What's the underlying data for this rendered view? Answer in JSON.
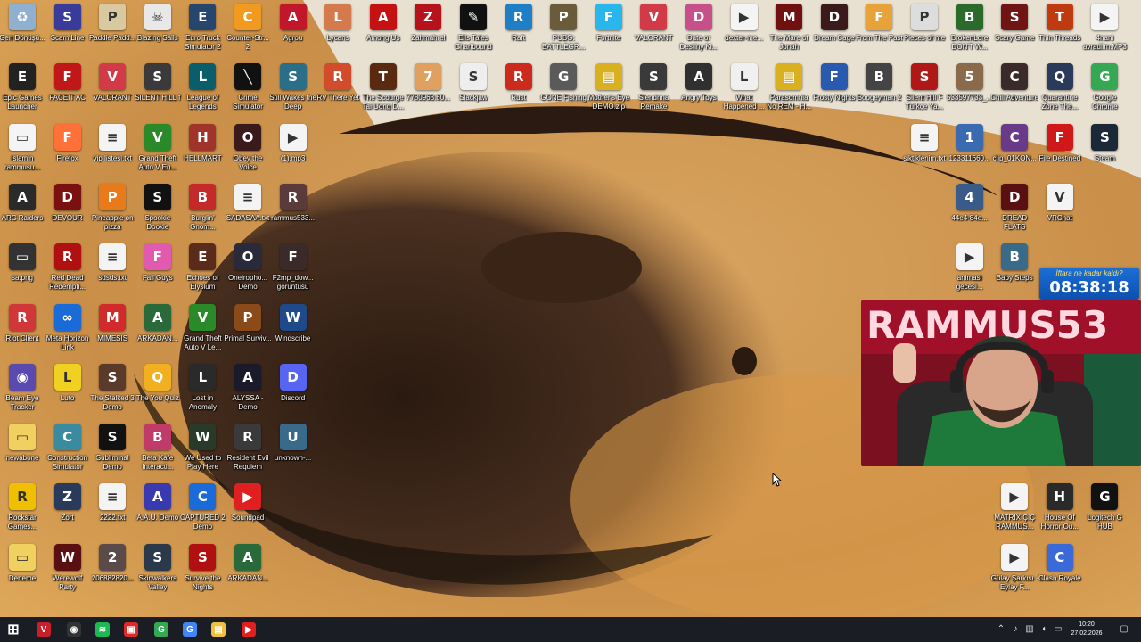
{
  "desktop": {
    "icons": [
      {
        "label": "Geri Dönüşü...",
        "color": "#8fb0d0",
        "glyph": "♻",
        "icon": "recycle-bin-icon"
      },
      {
        "label": "Scam Line",
        "color": "#3a3a9a",
        "glyph": "S",
        "icon": "game-icon"
      },
      {
        "label": "Paddle Padd...",
        "color": "#d9c9a0",
        "glyph": "P",
        "icon": "game-icon"
      },
      {
        "label": "Blazing Sails",
        "color": "#e8e8e8",
        "glyph": "☠",
        "icon": "game-icon"
      },
      {
        "label": "Euro Truck Simulator 2",
        "color": "#26466e",
        "glyph": "E",
        "icon": "game-icon"
      },
      {
        "label": "Counter-Str... 2",
        "color": "#f29a1f",
        "glyph": "C",
        "icon": "game-icon"
      },
      {
        "label": "Agrou",
        "color": "#c0182a",
        "glyph": "A",
        "icon": "game-icon"
      },
      {
        "label": "Lycans",
        "color": "#d57a4c",
        "glyph": "L",
        "icon": "game-icon"
      },
      {
        "label": "Among Us",
        "color": "#c51111",
        "glyph": "A",
        "icon": "game-icon"
      },
      {
        "label": "Zahmahrel",
        "color": "#b5121b",
        "glyph": "Z",
        "icon": "game-icon"
      },
      {
        "label": "Ells Tales Charlbound",
        "color": "#111",
        "glyph": "✎",
        "icon": "game-icon"
      },
      {
        "label": "Raft",
        "color": "#1f7fc6",
        "glyph": "R",
        "icon": "game-icon"
      },
      {
        "label": "PUBG: BATTLEGR...",
        "color": "#6a5b3a",
        "glyph": "P",
        "icon": "game-icon"
      },
      {
        "label": "Fortnite",
        "color": "#29b6ec",
        "glyph": "F",
        "icon": "game-icon"
      },
      {
        "label": "VALORANT",
        "color": "#d33a48",
        "glyph": "V",
        "icon": "game-icon"
      },
      {
        "label": "Date or Destiny Ki...",
        "color": "#c7508a",
        "glyph": "D",
        "icon": "game-icon"
      },
      {
        "label": "dexter-me...",
        "color": "#f4f4f4",
        "glyph": "▶",
        "icon": "video-file-icon"
      },
      {
        "label": "The Mare of Jonah",
        "color": "#701010",
        "glyph": "M",
        "icon": "game-icon"
      },
      {
        "label": "Dream Cage",
        "color": "#3a1a1a",
        "glyph": "D",
        "icon": "game-icon"
      },
      {
        "label": "From The Past",
        "color": "#e8a23a",
        "glyph": "F",
        "icon": "game-icon"
      },
      {
        "label": "Pieces of me",
        "color": "#dddddd",
        "glyph": "P",
        "icon": "game-icon"
      },
      {
        "label": "BrokenLore DON'T W...",
        "color": "#2a6a2a",
        "glyph": "B",
        "icon": "game-icon"
      },
      {
        "label": "Scary Game",
        "color": "#701414",
        "glyph": "S",
        "icon": "game-icon"
      },
      {
        "label": "Thin Threads",
        "color": "#c03a10",
        "glyph": "T",
        "icon": "game-icon"
      },
      {
        "label": "4nani avradiim.MP3",
        "color": "#f4f4f4",
        "glyph": "▶",
        "icon": "audio-file-icon"
      },
      {
        "label": "Epic Games Launcher",
        "color": "#222",
        "glyph": "E",
        "icon": "epic-games-icon"
      },
      {
        "label": "FACEIT AC",
        "color": "#c01818",
        "glyph": "F",
        "icon": "faceit-icon"
      },
      {
        "label": "VALORANT",
        "color": "#d33a48",
        "glyph": "V",
        "icon": "game-icon"
      },
      {
        "label": "SILENT HILL f",
        "color": "#3a3a3a",
        "glyph": "S",
        "icon": "game-icon"
      },
      {
        "label": "League of Legends",
        "color": "#0a5d6a",
        "glyph": "L",
        "icon": "game-icon"
      },
      {
        "label": "Crime Simulator",
        "color": "#111",
        "glyph": "╲",
        "icon": "game-icon"
      },
      {
        "label": "Still Wakes the Deep",
        "color": "#2a6e8a",
        "glyph": "S",
        "icon": "game-icon"
      },
      {
        "label": "RV There Yet",
        "color": "#d24b2a",
        "glyph": "R",
        "icon": "game-icon"
      },
      {
        "label": "The Scourge Tai Uong D...",
        "color": "#5a2a10",
        "glyph": "T",
        "icon": "game-icon"
      },
      {
        "label": "7780968.60...",
        "color": "#e0a060",
        "glyph": "7",
        "icon": "image-file-icon"
      },
      {
        "label": "Slackjaw",
        "color": "#eeeeee",
        "glyph": "S",
        "icon": "game-icon"
      },
      {
        "label": "Rust",
        "color": "#cd2a1e",
        "glyph": "R",
        "icon": "game-icon"
      },
      {
        "label": "GONE Fishing",
        "color": "#5a5a5a",
        "glyph": "G",
        "icon": "game-icon"
      },
      {
        "label": "Mother's Eye DEMO.zip",
        "color": "#d8b020",
        "glyph": "▤",
        "icon": "zip-file-icon"
      },
      {
        "label": "Slendrina Remake",
        "color": "#3a3a3a",
        "glyph": "S",
        "icon": "game-icon"
      },
      {
        "label": "Angry Toys",
        "color": "#303030",
        "glyph": "A",
        "icon": "game-icon"
      },
      {
        "label": "What Happened ...",
        "color": "#f0f0f0",
        "glyph": "L",
        "icon": "game-icon"
      },
      {
        "label": "Parasomnia No REM - H...",
        "color": "#d8b020",
        "glyph": "▤",
        "icon": "zip-file-icon"
      },
      {
        "label": "Frosty Nights",
        "color": "#2a5ab0",
        "glyph": "F",
        "icon": "game-icon"
      },
      {
        "label": "Boogeyman 2",
        "color": "#444",
        "glyph": "B",
        "icon": "game-icon"
      },
      {
        "label": "Silent Hill F Türkçe Ya...",
        "color": "#b01818",
        "glyph": "S",
        "icon": "game-icon"
      },
      {
        "label": "533597733_...",
        "color": "#8a6a4a",
        "glyph": "5",
        "icon": "image-file-icon"
      },
      {
        "label": "Chill Adventure",
        "color": "#3a2a2a",
        "glyph": "C",
        "icon": "game-icon"
      },
      {
        "label": "Quarantine Zone The...",
        "color": "#2a3a5a",
        "glyph": "Q",
        "icon": "game-icon"
      },
      {
        "label": "Google Chrome",
        "color": "#34a853",
        "glyph": "G",
        "icon": "chrome-icon"
      },
      {
        "label": "islamin rammusu...",
        "color": "#f4f4f4",
        "glyph": "▭",
        "icon": "file-icon"
      },
      {
        "label": "Firefox",
        "color": "#ff7139",
        "glyph": "F",
        "icon": "firefox-icon"
      },
      {
        "label": "vip listesi.txt",
        "color": "#f4f4f4",
        "glyph": "≡",
        "icon": "text-file-icon"
      },
      {
        "label": "Grand Theft Auto V En...",
        "color": "#2a8a2a",
        "glyph": "V",
        "icon": "game-icon"
      },
      {
        "label": "HELLMART",
        "color": "#a0342a",
        "glyph": "H",
        "icon": "game-icon"
      },
      {
        "label": "Obey the Voice",
        "color": "#3a1a1a",
        "glyph": "O",
        "icon": "game-icon"
      },
      {
        "label": "(1).mp3",
        "color": "#f4f4f4",
        "glyph": "▶",
        "icon": "audio-file-icon"
      },
      {
        "label": "siktiklenim.txt",
        "color": "#f4f4f4",
        "glyph": "≡",
        "icon": "text-file-icon"
      },
      {
        "label": "123311660...",
        "color": "#3a6ab0",
        "glyph": "1",
        "icon": "image-file-icon"
      },
      {
        "label": "clip_01KON...",
        "color": "#6a3a8a",
        "glyph": "C",
        "icon": "video-file-icon"
      },
      {
        "label": "File Destined",
        "color": "#d01818",
        "glyph": "F",
        "icon": "game-icon"
      },
      {
        "label": "Steam",
        "color": "#1b2838",
        "glyph": "S",
        "icon": "steam-icon"
      },
      {
        "label": "ARC Raiders",
        "color": "#2a2a2a",
        "glyph": "A",
        "icon": "game-icon"
      },
      {
        "label": "DEVOUR",
        "color": "#7a1010",
        "glyph": "D",
        "icon": "game-icon"
      },
      {
        "label": "Pineapple on pizza",
        "color": "#e87a1a",
        "glyph": "P",
        "icon": "game-icon"
      },
      {
        "label": "Spookie Dookie",
        "color": "#111",
        "glyph": "S",
        "icon": "game-icon"
      },
      {
        "label": "Burglin' Gnom...",
        "color": "#c42a2a",
        "glyph": "B",
        "icon": "game-icon"
      },
      {
        "label": "SADASAA.txt",
        "color": "#f4f4f4",
        "glyph": "≡",
        "icon": "text-file-icon"
      },
      {
        "label": "rammus533...",
        "color": "#5a3a3a",
        "glyph": "R",
        "icon": "image-file-icon"
      },
      {
        "label": "44e4-84e...",
        "color": "#3a5a8a",
        "glyph": "4",
        "icon": "image-file-icon"
      },
      {
        "label": "DREAD FLATS",
        "color": "#5a1010",
        "glyph": "D",
        "icon": "game-icon"
      },
      {
        "label": "VRChat",
        "color": "#f4f4f4",
        "glyph": "V",
        "icon": "vrchat-icon"
      },
      {
        "label": "sa.png",
        "color": "#333",
        "glyph": "▭",
        "icon": "image-file-icon"
      },
      {
        "label": "Red Dead Redempti...",
        "color": "#b01010",
        "glyph": "R",
        "icon": "game-icon"
      },
      {
        "label": "sdsds.txt",
        "color": "#f4f4f4",
        "glyph": "≡",
        "icon": "text-file-icon"
      },
      {
        "label": "Fall Guys",
        "color": "#e05ab0",
        "glyph": "F",
        "icon": "game-icon"
      },
      {
        "label": "Echoes of Elysium",
        "color": "#5a2a1a",
        "glyph": "E",
        "icon": "game-icon"
      },
      {
        "label": "Oneiropho... Demo",
        "color": "#2a2a3a",
        "glyph": "O",
        "icon": "game-icon"
      },
      {
        "label": "F2mp_dow... görüntüsü",
        "color": "#3a2a2a",
        "glyph": "F",
        "icon": "image-file-icon"
      },
      {
        "label": "animasi gecesi...",
        "color": "#f4f4f4",
        "glyph": "▶",
        "icon": "video-file-icon"
      },
      {
        "label": "Baby Steps",
        "color": "#3a6a8a",
        "glyph": "B",
        "icon": "game-icon"
      },
      {
        "label": "Riot Client",
        "color": "#d13639",
        "glyph": "R",
        "icon": "riot-client-icon"
      },
      {
        "label": "Meta Horizon Link",
        "color": "#1a6ad8",
        "glyph": "∞",
        "icon": "meta-horizon-icon"
      },
      {
        "label": "MIMESIS",
        "color": "#d02a2a",
        "glyph": "M",
        "icon": "game-icon"
      },
      {
        "label": "ARKADAN...",
        "color": "#2a6a3a",
        "glyph": "A",
        "icon": "game-icon"
      },
      {
        "label": "Grand Theft Auto V Le...",
        "color": "#2a8a2a",
        "glyph": "V",
        "icon": "game-icon"
      },
      {
        "label": "Primal Surviv...",
        "color": "#8a4a1a",
        "glyph": "P",
        "icon": "game-icon"
      },
      {
        "label": "Windscribe",
        "color": "#1e4a8a",
        "glyph": "W",
        "icon": "windscribe-icon"
      },
      {
        "label": "Beam Eye Tracker",
        "color": "#5a4ab0",
        "glyph": "◉",
        "icon": "beam-eye-icon"
      },
      {
        "label": "Luto",
        "color": "#f0d020",
        "glyph": "L",
        "icon": "game-icon"
      },
      {
        "label": "The Stalked 3 Demo",
        "color": "#5a3a2a",
        "glyph": "S",
        "icon": "game-icon"
      },
      {
        "label": "The You Quiz",
        "color": "#f0b020",
        "glyph": "Q",
        "icon": "game-icon"
      },
      {
        "label": "Lost in Anomaly",
        "color": "#2a2a2a",
        "glyph": "L",
        "icon": "game-icon"
      },
      {
        "label": "ALYSSA - Demo",
        "color": "#1a1a2a",
        "glyph": "A",
        "icon": "game-icon"
      },
      {
        "label": "Discord",
        "color": "#5865f2",
        "glyph": "D",
        "icon": "discord-icon"
      },
      {
        "label": "newabone",
        "color": "#f0d060",
        "glyph": "▭",
        "icon": "folder-icon"
      },
      {
        "label": "Construction Simulator",
        "color": "#3a8aa0",
        "glyph": "C",
        "icon": "game-icon"
      },
      {
        "label": "Subliminal Demo",
        "color": "#111",
        "glyph": "S",
        "icon": "game-icon"
      },
      {
        "label": "Beta Kafe Interacti...",
        "color": "#c03a6a",
        "glyph": "B",
        "icon": "game-icon"
      },
      {
        "label": "We Used to Play Here",
        "color": "#2a3a2a",
        "glyph": "W",
        "icon": "game-icon"
      },
      {
        "label": "Resident Evil Requiem",
        "color": "#3a3a3a",
        "glyph": "R",
        "icon": "game-icon"
      },
      {
        "label": "unknown-...",
        "color": "#3a6a8a",
        "glyph": "U",
        "icon": "image-file-icon"
      },
      {
        "label": "MATRIX ÇIÇ RAMMUS...",
        "color": "#f4f4f4",
        "glyph": "▶",
        "icon": "video-file-icon"
      },
      {
        "label": "House Of Horror Ou...",
        "color": "#2a2a2a",
        "glyph": "H",
        "icon": "game-icon"
      },
      {
        "label": "Logitech G HUB",
        "color": "#111",
        "glyph": "G",
        "icon": "logitech-icon"
      },
      {
        "label": "Rockstar Games...",
        "color": "#f0c000",
        "glyph": "R",
        "icon": "rockstar-icon"
      },
      {
        "label": "Zort",
        "color": "#2a3a5a",
        "glyph": "Z",
        "icon": "game-icon"
      },
      {
        "label": "2222.txt",
        "color": "#f4f4f4",
        "glyph": "≡",
        "icon": "text-file-icon"
      },
      {
        "label": "A.A.U. Demo",
        "color": "#3a3ab0",
        "glyph": "A",
        "icon": "game-icon"
      },
      {
        "label": "CAPTURED 2 Demo",
        "color": "#1a6ad8",
        "glyph": "C",
        "icon": "game-icon"
      },
      {
        "label": "Soundpad",
        "color": "#e02020",
        "glyph": "▶",
        "icon": "soundpad-icon"
      },
      {
        "label": "Deneme",
        "color": "#f0d060",
        "glyph": "▭",
        "icon": "folder-icon"
      },
      {
        "label": "Werewolf Party",
        "color": "#5a1010",
        "glyph": "W",
        "icon": "game-icon"
      },
      {
        "label": "206882820...",
        "color": "#5a4a4a",
        "glyph": "2",
        "icon": "image-file-icon"
      },
      {
        "label": "Skinwalkers Valley",
        "color": "#2a3a4a",
        "glyph": "S",
        "icon": "game-icon"
      },
      {
        "label": "Survive the Nights",
        "color": "#b01010",
        "glyph": "S",
        "icon": "game-icon"
      },
      {
        "label": "ARKADAN...",
        "color": "#2a6a3a",
        "glyph": "A",
        "icon": "game-icon"
      },
      {
        "label": "Gülay Şarkısı - Eylay F...",
        "color": "#f4f4f4",
        "glyph": "▶",
        "icon": "video-file-icon"
      },
      {
        "label": "Clash Royale",
        "color": "#3a6ad8",
        "glyph": "C",
        "icon": "game-icon"
      }
    ]
  },
  "overlay": {
    "timer_caption": "İftara ne kadar kaldı?",
    "timer_value": "08:38:18",
    "webcam_text": "RAMMUS53"
  },
  "taskbar": {
    "apps": [
      {
        "name": "start-button",
        "color": "#ffffff",
        "glyph": "⊞"
      },
      {
        "name": "taskbar-app-voicemeeter",
        "color": "#c8202a",
        "glyph": "V"
      },
      {
        "name": "taskbar-app-obs",
        "color": "#333333",
        "glyph": "◉"
      },
      {
        "name": "taskbar-app-spotify",
        "color": "#1db954",
        "glyph": "≋"
      },
      {
        "name": "taskbar-app-video-editor",
        "color": "#e02a2a",
        "glyph": "▣"
      },
      {
        "name": "taskbar-app-chrome",
        "color": "#34a853",
        "glyph": "G"
      },
      {
        "name": "taskbar-app-chrome-profile",
        "color": "#4285f4",
        "glyph": "G"
      },
      {
        "name": "taskbar-app-explorer",
        "color": "#f0c040",
        "glyph": "▤"
      },
      {
        "name": "taskbar-app-youtube",
        "color": "#e02020",
        "glyph": "▶"
      }
    ],
    "time": "10:20",
    "date": "27.02.2026"
  }
}
